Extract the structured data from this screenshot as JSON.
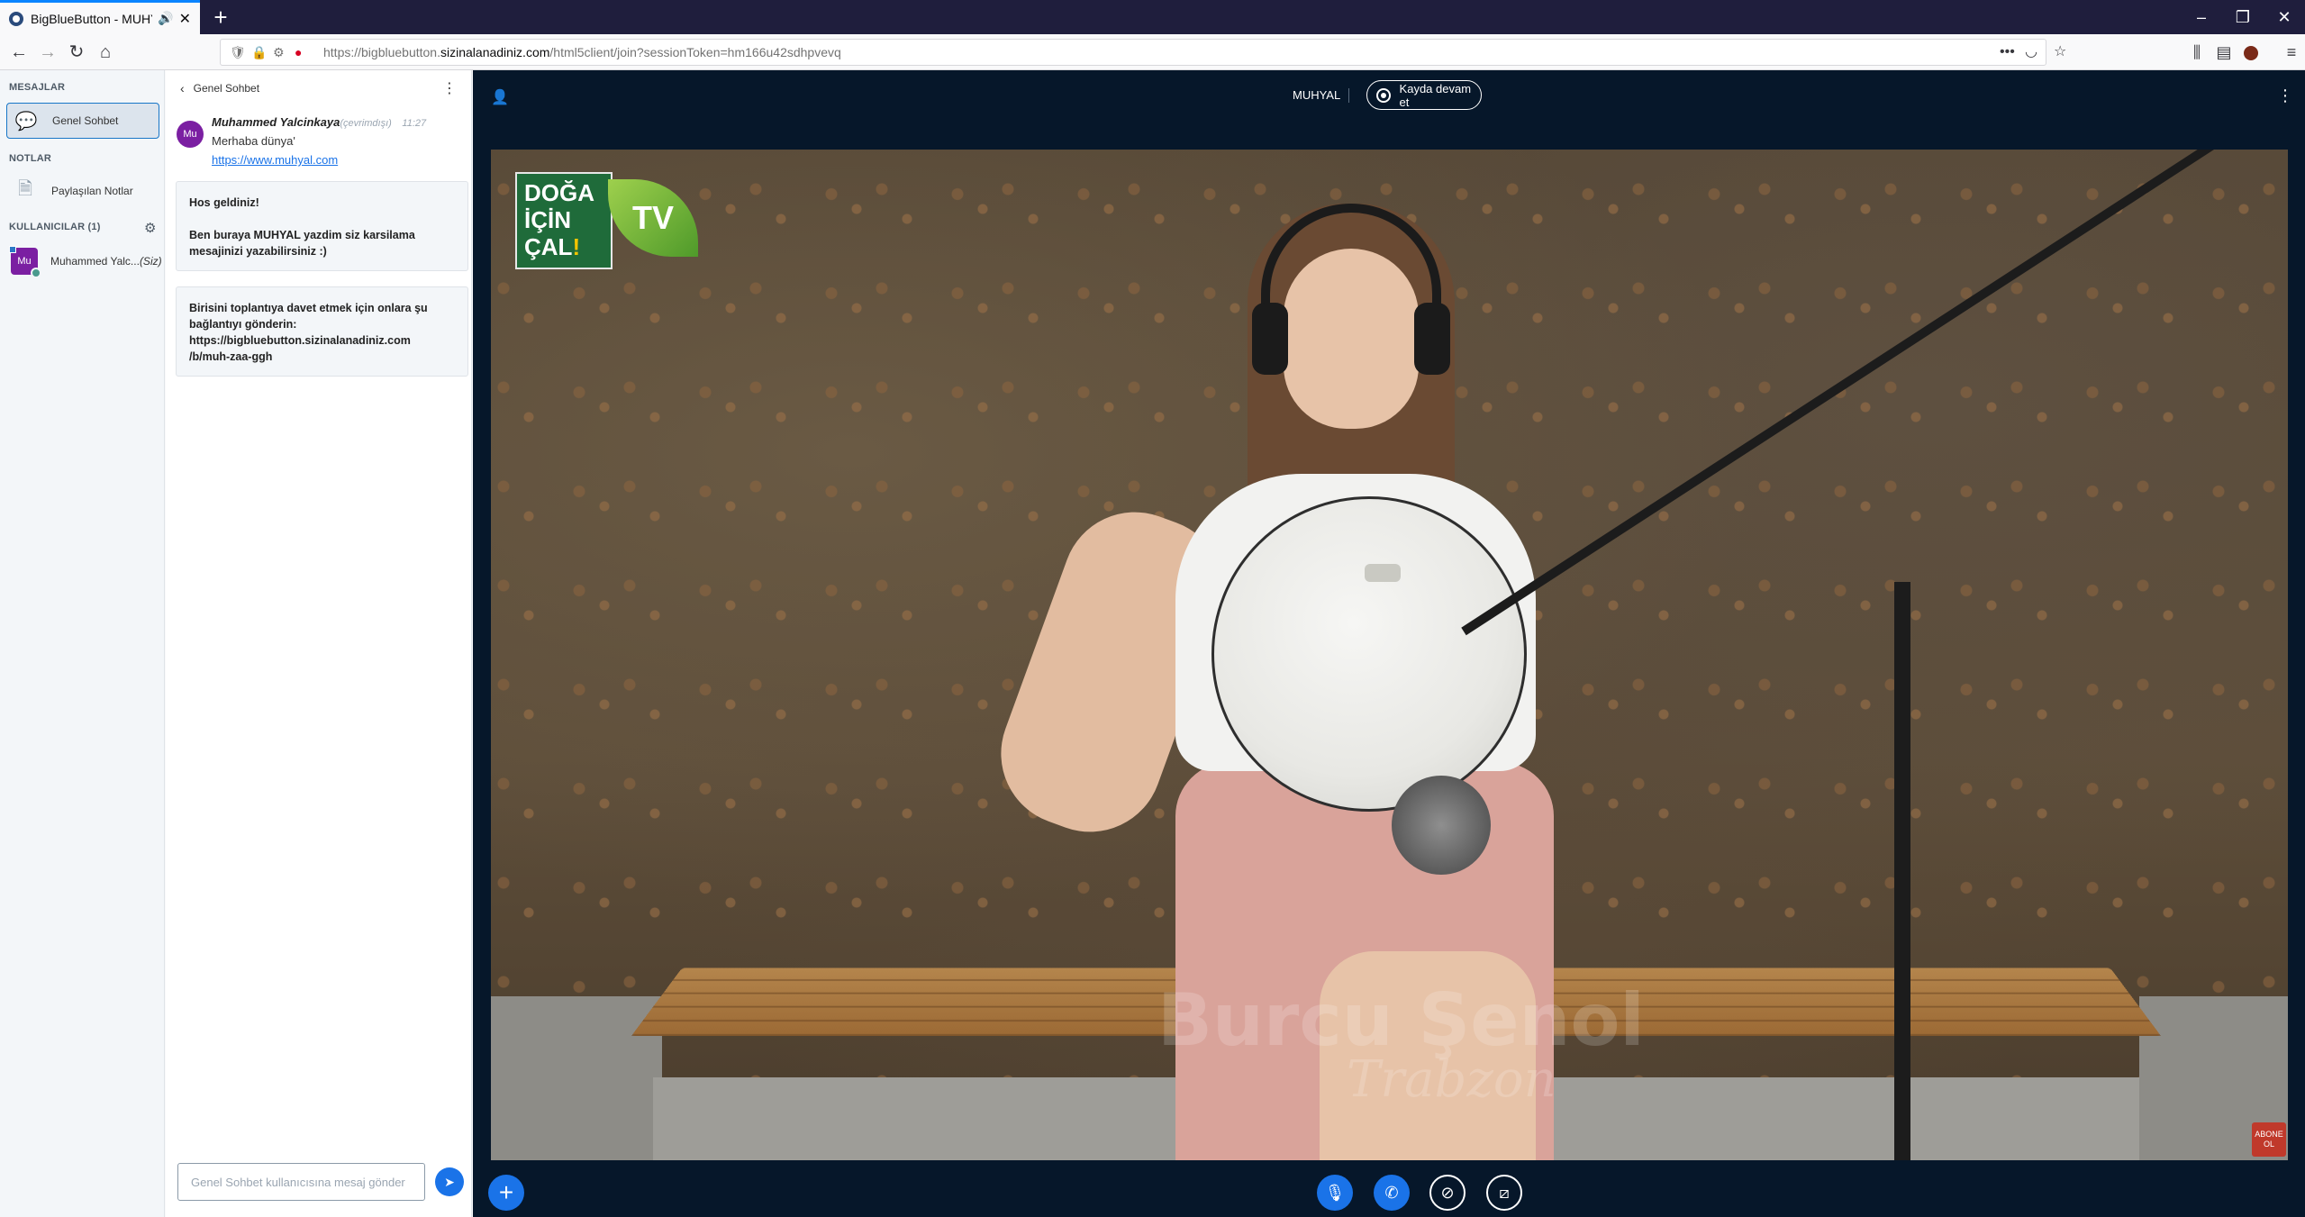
{
  "browser": {
    "tab_title": "BigBlueButton - MUHYAL",
    "url_prefix": "https://bigbluebutton.",
    "url_host": "sizinalanadiniz.com",
    "url_suffix": "/html5client/join?sessionToken=hm166u42sdhpvevq"
  },
  "sidebar": {
    "messages_heading": "MESAJLAR",
    "public_chat_label": "Genel Sohbet",
    "notes_heading": "NOTLAR",
    "shared_notes_label": "Paylaşılan Notlar",
    "users_heading": "KULLANICILAR (1)",
    "user": {
      "initials": "Mu",
      "name": "Muhammed Yalc...",
      "you_label": "(Siz)"
    }
  },
  "chat": {
    "header_title": "Genel Sohbet",
    "message": {
      "avatar_initials": "Mu",
      "sender": "Muhammed Yalcinkaya",
      "status": "(çevrimdışı)",
      "time": "11:27",
      "text": "Merhaba dünya'",
      "link": "https://www.muhyal.com"
    },
    "welcome_line1": "Hos geldiniz!",
    "welcome_line2": "Ben buraya MUHYAL yazdim siz karsilama mesajinizi yazabilirsiniz :)",
    "invite_line1": "Birisini toplantıya davet etmek için onlara şu bağlantıyı gönderin:",
    "invite_line2": "https://bigbluebutton.sizinalanadiniz.com",
    "invite_line3": "/b/muh-zaa-ggh",
    "input_placeholder": "Genel Sohbet kullanıcısına mesaj gönder"
  },
  "main": {
    "meeting_title": "MUHYAL",
    "record_label": "Kayda devam et"
  },
  "video": {
    "logo_line1": "DOĞA",
    "logo_line2": "İÇİN",
    "logo_line3": "ÇAL",
    "logo_tv": "TV",
    "watermark_name": "Burcu Şenol",
    "watermark_place": "Trabzon",
    "subscribe_label": "ABONE OL"
  },
  "icons": {
    "accent": "#1a73e8",
    "background": "#06172a"
  }
}
